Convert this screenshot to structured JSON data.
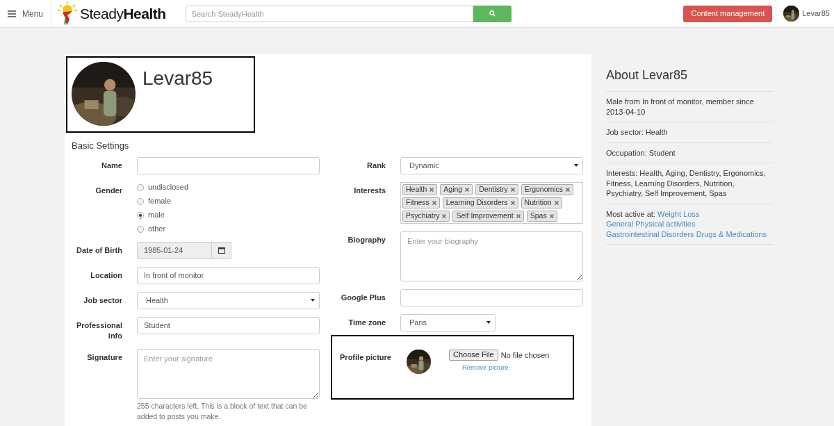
{
  "header": {
    "menu_label": "Menu",
    "logo": "Steady**Health**",
    "search": {
      "placeholder": "Search SteadyHealth"
    },
    "content_button": "Content management",
    "user": "Levar85"
  },
  "profile": {
    "username": "Levar85"
  },
  "basic_settings": {
    "title": "Basic Settings",
    "left_fields": [
      {
        "kind": "text",
        "label": "Name"
      },
      {
        "kind": "radio",
        "label": "Gender",
        "options": [
          {
            "label": "undisclosed",
            "selected": false
          },
          {
            "label": "female",
            "selected": false
          },
          {
            "label": "male",
            "selected": true
          },
          {
            "label": "other",
            "selected": false
          }
        ]
      },
      {
        "kind": "date",
        "label": "Date of Birth",
        "value": "1985-01-24"
      },
      {
        "kind": "text",
        "label": "Location",
        "value": "In front of monitor"
      },
      {
        "kind": "select",
        "label": "Job sector",
        "value": "Health"
      },
      {
        "kind": "text",
        "label": "Professional info",
        "value": "Student"
      },
      {
        "kind": "textarea",
        "label": "Signature",
        "placeholder": "Enter your signature",
        "help": "255 characters left. This is a block of text that can be added to posts you make."
      }
    ],
    "right_fields": [
      {
        "kind": "select",
        "label": "Rank",
        "value": "Dynamic"
      },
      {
        "kind": "tags",
        "label": "Interests",
        "tags": [
          "Health",
          "Aging",
          "Dentistry",
          "Ergonomics",
          "Fitness",
          "Learning Disorders",
          "Nutrition",
          "Psychiatry",
          "Self Improvement",
          "Spas"
        ]
      },
      {
        "kind": "textarea",
        "label": "Biography",
        "placeholder": "Enter your biography"
      },
      {
        "kind": "text",
        "label": "Google Plus"
      },
      {
        "kind": "select",
        "label": "Time zone",
        "value": "Paris",
        "short": true
      },
      {
        "kind": "file",
        "label": "Profile picture",
        "button": "Choose File",
        "status": "No file chosen",
        "link": "Remove picture"
      }
    ]
  },
  "about": {
    "title": "About Levar85",
    "items": [
      {
        "text": "Male from In front of monitor, member since 2013-04-10"
      },
      {
        "text": "Job sector: Health"
      },
      {
        "text": "Occupation: Student"
      },
      {
        "text": "Interests: Health, Aging, Dentistry, Ergonomics, Fitness, Learning Disorders, Nutrition, Psychiatry, Self Improvement, Spas"
      },
      {
        "text": "Most active at:",
        "links": [
          "Weight Loss",
          "General Physical activities",
          "Gastrointestinal Disorders",
          "Drugs & Medications"
        ]
      }
    ]
  }
}
